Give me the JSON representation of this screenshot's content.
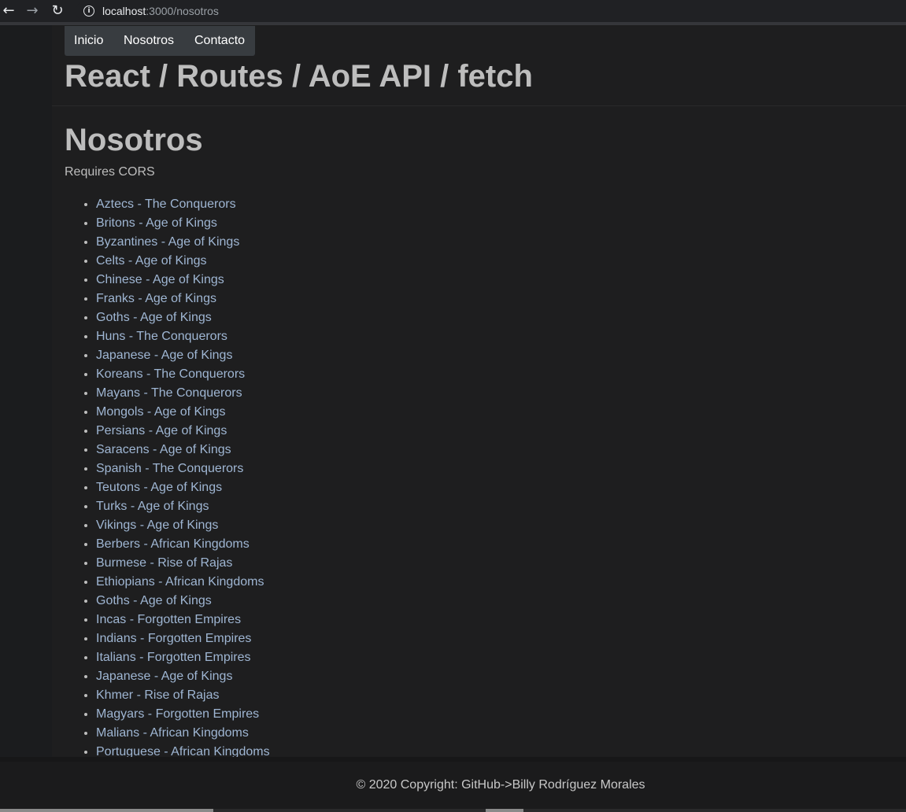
{
  "browser": {
    "back_icon": "arrow-left-icon",
    "forward_icon": "arrow-right-icon",
    "reload_icon": "reload-icon",
    "info_icon": "info-icon",
    "url_host": "localhost",
    "url_rest": ":3000/nosotros"
  },
  "nav": {
    "items": [
      {
        "label": "Inicio"
      },
      {
        "label": "Nosotros"
      },
      {
        "label": "Contacto"
      }
    ]
  },
  "site_title": "React / Routes / AoE API / fetch",
  "page": {
    "heading": "Nosotros",
    "note": "Requires CORS",
    "civilizations": [
      "Aztecs - The Conquerors",
      "Britons - Age of Kings",
      "Byzantines - Age of Kings",
      "Celts - Age of Kings",
      "Chinese - Age of Kings",
      "Franks - Age of Kings",
      "Goths - Age of Kings",
      "Huns - The Conquerors",
      "Japanese - Age of Kings",
      "Koreans - The Conquerors",
      "Mayans - The Conquerors",
      "Mongols - Age of Kings",
      "Persians - Age of Kings",
      "Saracens - Age of Kings",
      "Spanish - The Conquerors",
      "Teutons - Age of Kings",
      "Turks - Age of Kings",
      "Vikings - Age of Kings",
      "Berbers - African Kingdoms",
      "Burmese - Rise of Rajas",
      "Ethiopians - African Kingdoms",
      "Goths - Age of Kings",
      "Incas - Forgotten Empires",
      "Indians - Forgotten Empires",
      "Italians - Forgotten Empires",
      "Japanese - Age of Kings",
      "Khmer - Rise of Rajas",
      "Magyars - Forgotten Empires",
      "Malians - African Kingdoms",
      "Portuguese - African Kingdoms"
    ]
  },
  "footer": {
    "copyright": "© 2020 Copyright: GitHub->Billy Rodríguez Morales"
  },
  "colors": {
    "background": "#1e1e1f",
    "heading": "#bdbdbd",
    "link": "#9fb6d3",
    "navbar": "#383c40"
  }
}
